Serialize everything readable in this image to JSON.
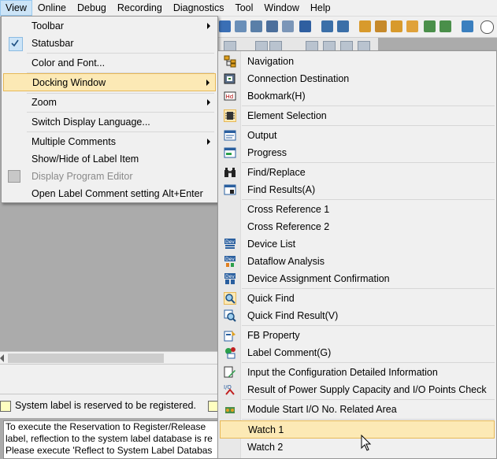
{
  "menubar": {
    "items": [
      "View",
      "Online",
      "Debug",
      "Recording",
      "Diagnostics",
      "Tool",
      "Window",
      "Help"
    ],
    "active": "View"
  },
  "view_menu": {
    "items": [
      {
        "label": "Toolbar",
        "submenu": true
      },
      {
        "label": "Statusbar",
        "checked": true
      },
      {
        "label": "Color and Font..."
      },
      {
        "label": "Docking Window",
        "submenu": true,
        "highlighted": true
      },
      {
        "label": "Zoom",
        "submenu": true
      },
      {
        "label": "Switch Display Language..."
      },
      {
        "label": "Multiple Comments",
        "submenu": true
      },
      {
        "label": "Show/Hide of Label Item"
      },
      {
        "label": "Display Program Editor",
        "disabled": true
      },
      {
        "label": "Open Label Comment setting",
        "shortcut": "Alt+Enter"
      }
    ]
  },
  "docking_menu": {
    "items": [
      {
        "label": "Navigation",
        "icon": "navigation-icon"
      },
      {
        "label": "Connection Destination",
        "icon": "connection-destination-icon"
      },
      {
        "label": "Bookmark(H)",
        "icon": "bookmark-icon"
      },
      {
        "label": "Element Selection",
        "icon": "element-selection-icon",
        "icon_selected": true
      },
      {
        "label": "Output",
        "icon": "output-icon"
      },
      {
        "label": "Progress",
        "icon": "progress-icon"
      },
      {
        "label": "Find/Replace",
        "icon": "binoculars-icon"
      },
      {
        "label": "Find Results(A)",
        "icon": "find-results-icon"
      },
      {
        "label": "Cross Reference 1",
        "icon": ""
      },
      {
        "label": "Cross Reference 2",
        "icon": ""
      },
      {
        "label": "Device List",
        "icon": "device-list-icon"
      },
      {
        "label": "Dataflow Analysis",
        "icon": "dataflow-analysis-icon"
      },
      {
        "label": "Device Assignment Confirmation",
        "icon": "device-assignment-icon"
      },
      {
        "label": "Quick Find",
        "icon": "quick-find-icon",
        "icon_selected": true
      },
      {
        "label": "Quick Find Result(V)",
        "icon": "quick-find-result-icon"
      },
      {
        "label": "FB Property",
        "icon": "fb-property-icon"
      },
      {
        "label": "Label Comment(G)",
        "icon": "label-comment-icon"
      },
      {
        "label": "Input the Configuration Detailed Information",
        "icon": "config-input-icon"
      },
      {
        "label": "Result of Power Supply Capacity and I/O Points Check",
        "icon": "power-check-icon"
      },
      {
        "label": "Module Start I/O No. Related Area",
        "icon": "module-start-icon"
      },
      {
        "label": "Watch 1",
        "icon": "",
        "highlighted": true
      },
      {
        "label": "Watch 2",
        "icon": ""
      }
    ]
  },
  "status": {
    "legend_text": "System label is reserved to be registered."
  },
  "info_box": {
    "lines": [
      "To execute the Reservation to Register/Release",
      "label, reflection to the system label database is re",
      "Please execute 'Reflect to System Label Databas"
    ]
  },
  "colors": {
    "menu_bg": "#f0f0f0",
    "highlight_bg": "#fce9b5",
    "highlight_border": "#e7b856",
    "workspace": "#ababab"
  }
}
